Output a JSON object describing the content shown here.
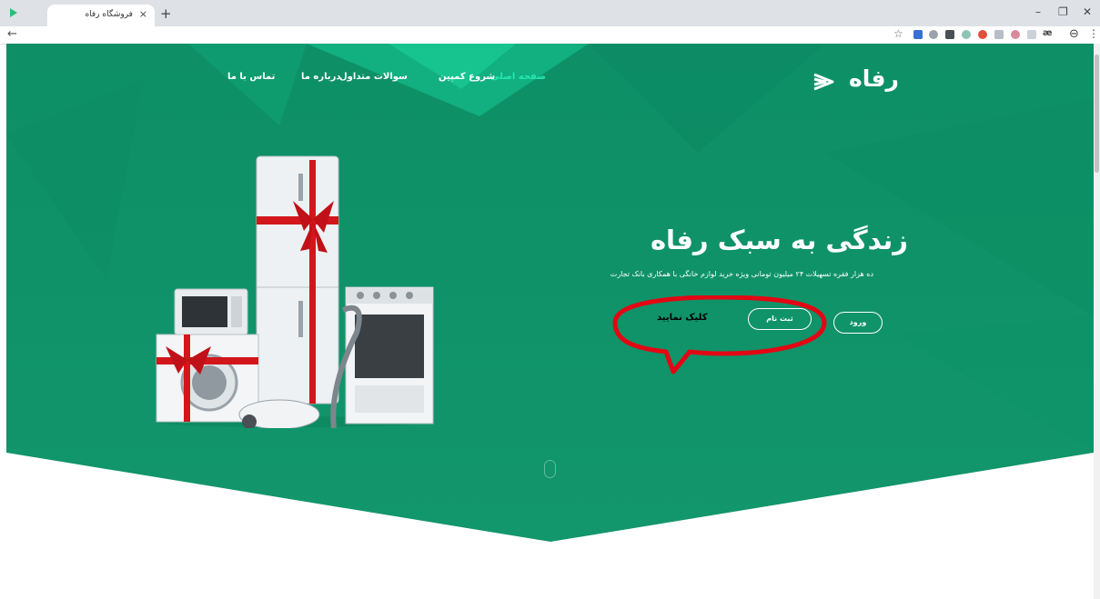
{
  "browser": {
    "tab_title": "فروشگاه رفاه",
    "tab_close": "×",
    "new_tab": "+",
    "back": "←",
    "window_controls": [
      "–",
      "❐",
      "✕"
    ],
    "toolbar_icons": [
      "star-icon",
      "extension-icons",
      "ae-icon",
      "profile-icon",
      "menu-icon"
    ],
    "ae_label": "æ"
  },
  "header": {
    "logo_text": "رفاه",
    "nav": [
      {
        "label": "صفحه اصلی",
        "active": true
      },
      {
        "label": "شروع کمپین",
        "active": false
      },
      {
        "label": "سوالات متداول",
        "active": false
      },
      {
        "label": "درباره ما",
        "active": false
      },
      {
        "label": "تماس با ما",
        "active": false
      }
    ]
  },
  "hero": {
    "title": "زندگی به سبک رفاه",
    "subtitle": "ده هزار فقره تسهیلات ۲۴ میلیون تومانی ویژه خرید لوازم خانگی با همکاری بانک تجارت",
    "login_button": "ورود",
    "register_button": "ثبت نام",
    "callout_text": "کلیک نمایید",
    "image": "home-appliances-with-red-ribbon"
  },
  "colors": {
    "brand_green": "#0f9468",
    "accent_green": "#23e8b0",
    "callout_red": "#e30613"
  }
}
